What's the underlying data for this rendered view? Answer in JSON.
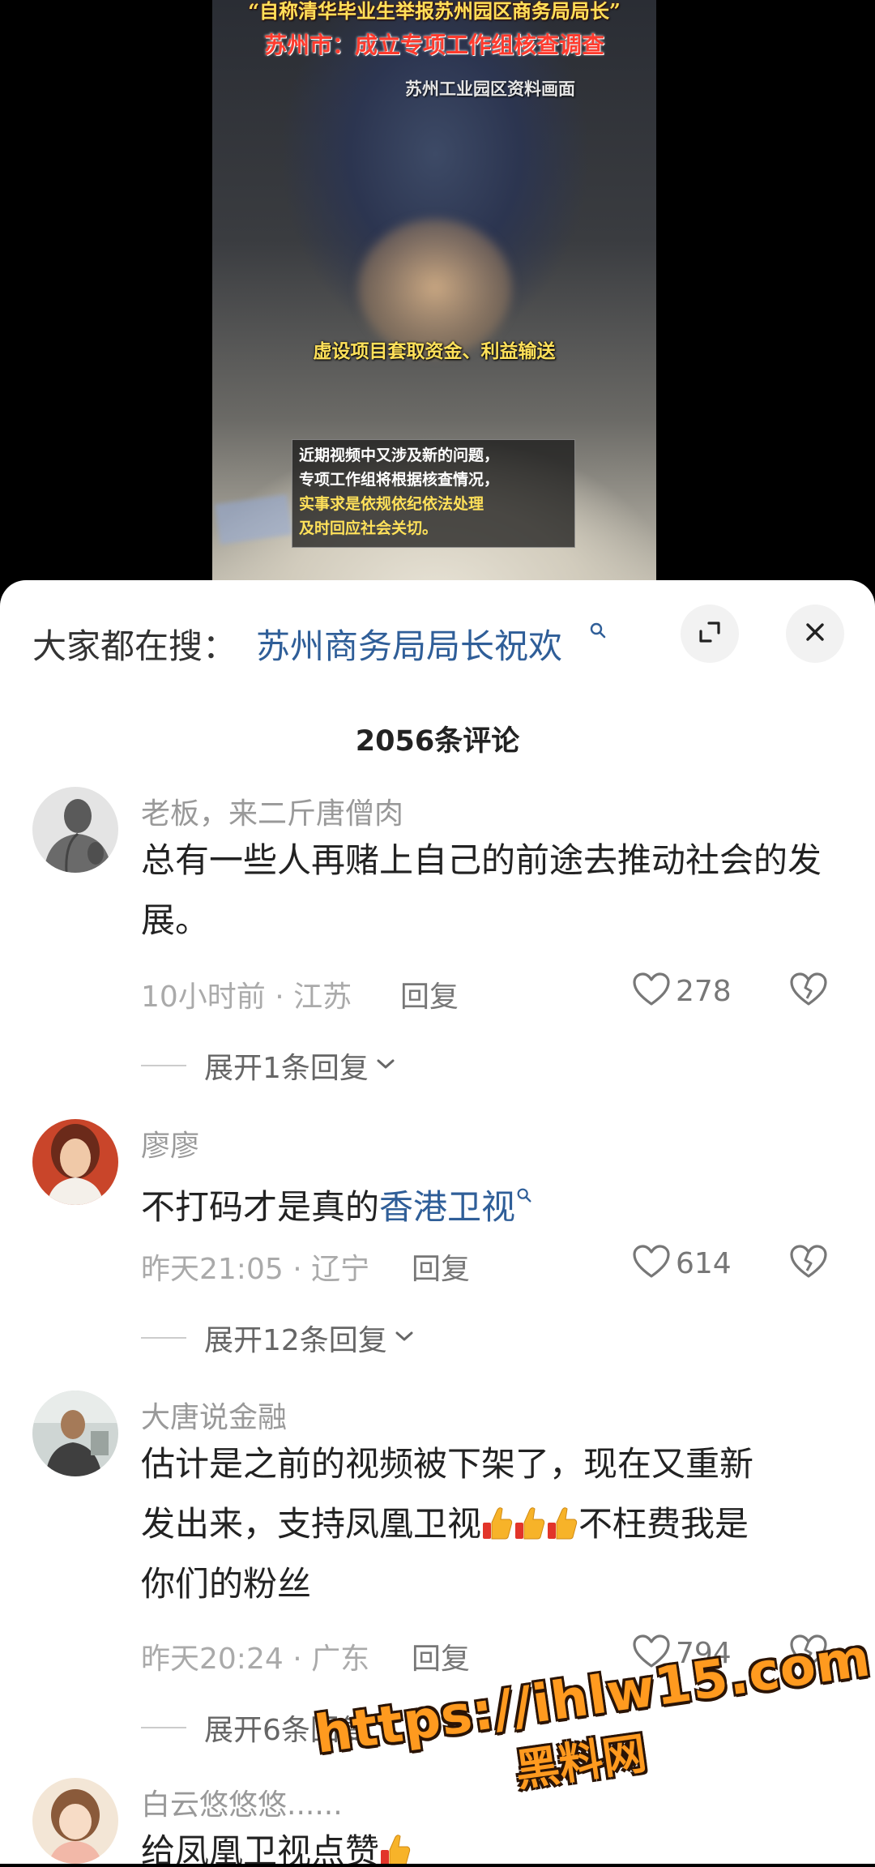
{
  "video": {
    "caption_top": "“自称清华毕业生举报苏州园区商务局局长”",
    "caption_title": "苏州市：成立专项工作组核查调查",
    "caption_source": "苏州工业园区资料画面",
    "caption_middle": "虚设项目套取资金、利益输送",
    "notice_lines": [
      "近期视频中又涉及新的问题，",
      "专项工作组将根据核查情况，",
      "实事求是依规依纪依法处理",
      "及时回应社会关切。"
    ]
  },
  "search": {
    "label": "大家都在搜：",
    "term": "苏州商务局局长祝欢"
  },
  "comment_count": "2056条评论",
  "comments": [
    {
      "author": "老板，来二斤唐僧肉",
      "text": "总有一些人再赌上自己的前途去推动社会的发展。",
      "time": "10小时前 · 江苏",
      "reply": "回复",
      "likes": "278",
      "expand": "展开1条回复"
    },
    {
      "author": "廖廖",
      "text_plain": "不打码才是真的",
      "text_link": "香港卫视",
      "time": "昨天21:05 · 辽宁",
      "reply": "回复",
      "likes": "614",
      "expand": "展开12条回复"
    },
    {
      "author": "大唐说金融",
      "text_line1": "估计是之前的视频被下架了，现在又重新",
      "text_line2a": "发出来，支持凤凰卫视",
      "text_line2b": "不枉费我是",
      "text_line3": "你们的粉丝",
      "time": "昨天20:24 · 广东",
      "reply": "回复",
      "likes": "794",
      "expand": "展开6条回复"
    },
    {
      "author": "白云悠悠悠......",
      "text": "给凤凰卫视点赞"
    }
  ],
  "watermark": {
    "line1": "https://ihlw15.com",
    "line2": "黑料网"
  },
  "icons": {
    "search": "search-icon",
    "expand": "expand-icon",
    "close": "close-icon",
    "like": "heart-icon",
    "dislike": "broken-heart-icon",
    "chevron": "chevron-down-icon",
    "thumbs": "thumbs-up-emoji"
  },
  "colors": {
    "link": "#2f5e98",
    "watermark": "#ff9a1f"
  }
}
